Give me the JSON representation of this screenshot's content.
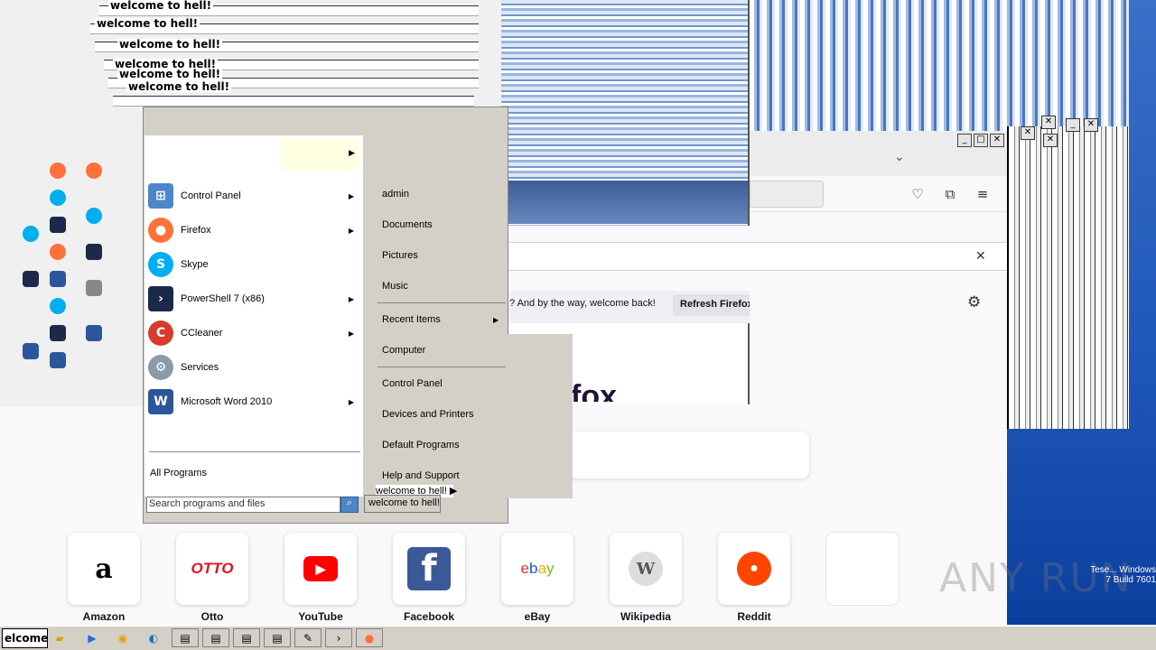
{
  "glitch": {
    "welcome_text": "welcome to hell!"
  },
  "start_menu": {
    "programs": [
      {
        "label": "Control Panel",
        "icon": "control-panel-icon",
        "has_arrow": true
      },
      {
        "label": "Firefox",
        "icon": "firefox-icon",
        "has_arrow": true
      },
      {
        "label": "Skype",
        "icon": "skype-icon",
        "has_arrow": false
      },
      {
        "label": "PowerShell 7 (x86)",
        "icon": "powershell-icon",
        "has_arrow": true
      },
      {
        "label": "CCleaner",
        "icon": "ccleaner-icon",
        "has_arrow": true
      },
      {
        "label": "Services",
        "icon": "services-icon",
        "has_arrow": false
      },
      {
        "label": "Microsoft Word 2010",
        "icon": "word-icon",
        "has_arrow": true
      }
    ],
    "all_programs": "All Programs",
    "search_placeholder": "Search programs and files",
    "shutdown_label": "welcome to hell!",
    "right_items": {
      "user": "admin",
      "documents": "Documents",
      "pictures": "Pictures",
      "music": "Music",
      "recent_items": "Recent Items",
      "computer": "Computer",
      "control_panel": "Control Panel",
      "devices_printers": "Devices and Printers",
      "default_programs": "Default Programs",
      "help_support": "Help and Support"
    }
  },
  "firefox": {
    "notification_text": "? And by the way, welcome back!",
    "refresh_button": "Refresh Firefox",
    "logo_text": "fox",
    "shortcuts": [
      {
        "label": "Amazon",
        "icon": "amazon-icon"
      },
      {
        "label": "Otto",
        "icon": "otto-icon"
      },
      {
        "label": "YouTube",
        "icon": "youtube-icon"
      },
      {
        "label": "Facebook",
        "icon": "facebook-icon"
      },
      {
        "label": "eBay",
        "icon": "ebay-icon"
      },
      {
        "label": "Wikipedia",
        "icon": "wikipedia-icon"
      },
      {
        "label": "Reddit",
        "icon": "reddit-icon"
      },
      {
        "label": "",
        "icon": "empty-tile"
      }
    ]
  },
  "watermark": {
    "brand": "ANY RUN",
    "corner_text": "Tese... Windows 7 Build 7601"
  },
  "taskbar": {
    "start_label": "elcome to"
  },
  "colors": {
    "start_menu_bg": "#d4d0c8",
    "submenu_highlight": "#ffffe1",
    "desktop_blue": "#1e56b8"
  }
}
